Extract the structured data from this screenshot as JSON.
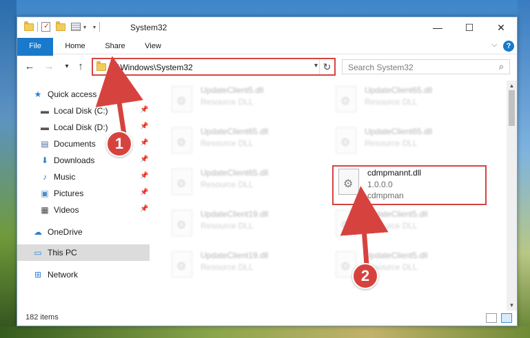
{
  "window": {
    "title": "System32"
  },
  "ribbon": {
    "tabs": [
      "File",
      "Home",
      "Share",
      "View"
    ],
    "help": "?"
  },
  "titlebar": {
    "minimize": "—",
    "maximize": "☐",
    "close": "✕"
  },
  "address": {
    "path": "C:\\Windows\\System32"
  },
  "search": {
    "placeholder": "Search System32"
  },
  "sidebar": {
    "items": [
      {
        "label": "Quick access",
        "icon": "star-icon",
        "pinned": false
      },
      {
        "label": "Local Disk (C:)",
        "icon": "drive-icon",
        "pinned": true
      },
      {
        "label": "Local Disk (D:)",
        "icon": "drive-icon",
        "pinned": true
      },
      {
        "label": "Documents",
        "icon": "documents-icon",
        "pinned": true
      },
      {
        "label": "Downloads",
        "icon": "download-icon",
        "pinned": true
      },
      {
        "label": "Music",
        "icon": "music-icon",
        "pinned": true
      },
      {
        "label": "Pictures",
        "icon": "pictures-icon",
        "pinned": true
      },
      {
        "label": "Videos",
        "icon": "videos-icon",
        "pinned": true
      },
      {
        "label": "OneDrive",
        "icon": "cloud-icon",
        "pinned": false
      },
      {
        "label": "This PC",
        "icon": "computer-icon",
        "pinned": false,
        "selected": true
      },
      {
        "label": "Network",
        "icon": "network-icon",
        "pinned": false
      }
    ]
  },
  "files": [
    {
      "name": "UpdateClient5.dll",
      "type": "Resource DLL"
    },
    {
      "name": "UpdateClient65.dll",
      "type": "Resource DLL"
    },
    {
      "name": "UpdateClient65.dll",
      "type": "Resource DLL"
    },
    {
      "name": "UpdateClient65.dll",
      "type": "Resource DLL"
    },
    {
      "name": "UpdateClient65.dll",
      "type": "Resource DLL"
    },
    {
      "name": "cdmpmannt.dll",
      "version": "1.0.0.0",
      "description": "cdmpman"
    },
    {
      "name": "UpdateClient19.dll",
      "type": "Resource DLL"
    },
    {
      "name": "UpdateClient5.dll",
      "type": "Resource DLL"
    },
    {
      "name": "UpdateClient19.dll",
      "type": "Resource DLL"
    },
    {
      "name": "UpdateClient5.dll",
      "type": "Resource DLL"
    }
  ],
  "status": {
    "item_count": "182 items"
  },
  "callouts": [
    "1",
    "2"
  ],
  "colors": {
    "accent": "#1979ca",
    "highlight": "#d6433f"
  }
}
